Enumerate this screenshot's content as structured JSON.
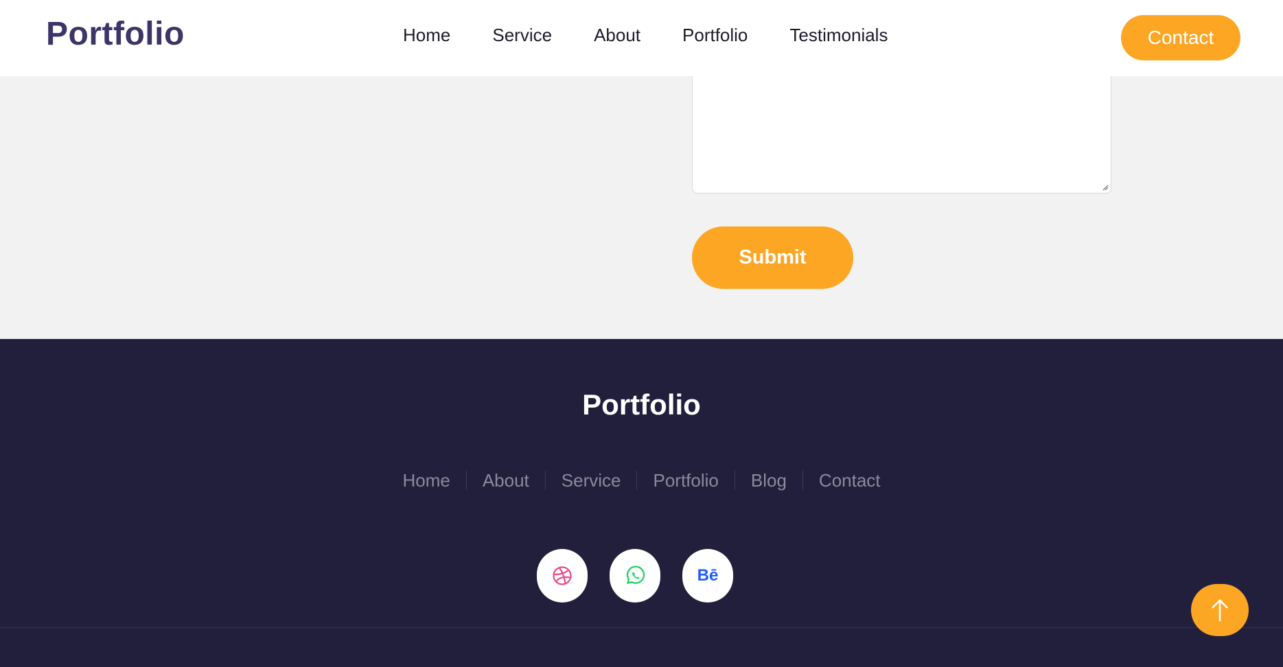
{
  "header": {
    "logo": "Portfolio",
    "nav": [
      "Home",
      "Service",
      "About",
      "Portfolio",
      "Testimonials"
    ],
    "contact_label": "Contact"
  },
  "form": {
    "message_value": "",
    "submit_label": "Submit"
  },
  "footer": {
    "logo": "Portfolio",
    "nav": [
      "Home",
      "About",
      "Service",
      "Portfolio",
      "Blog",
      "Contact"
    ],
    "social": [
      {
        "icon": "dribbble-icon",
        "color": "#ea4c89"
      },
      {
        "icon": "whatsapp-icon",
        "color": "#25d366"
      },
      {
        "icon": "behance-icon",
        "text": "Bē",
        "color": "#1d5cff"
      }
    ]
  },
  "colors": {
    "accent": "#fca624",
    "brand": "#3c3568",
    "footer_bg": "#211f3c",
    "section_bg": "#f2f2f2"
  }
}
